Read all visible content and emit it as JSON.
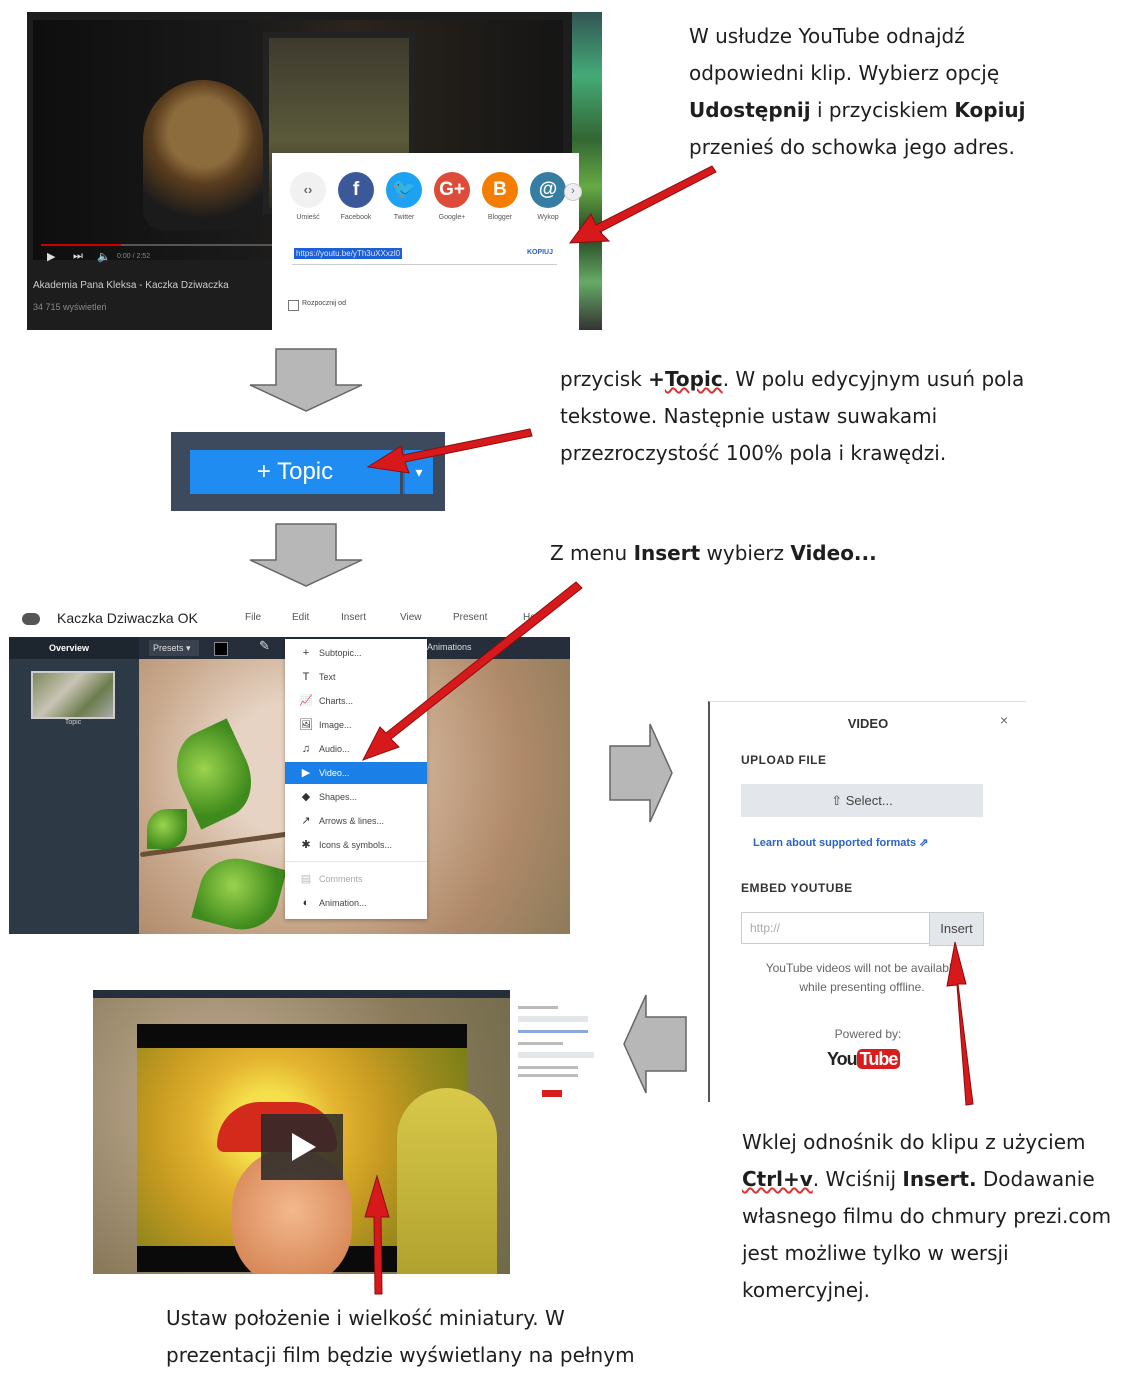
{
  "youtube": {
    "share_targets": [
      {
        "label": "Umieść",
        "glyph": "‹›",
        "color": "#f1f1f1"
      },
      {
        "label": "Facebook",
        "glyph": "f",
        "color": "#3b5998"
      },
      {
        "label": "Twitter",
        "glyph": "🐦",
        "color": "#1da1f2"
      },
      {
        "label": "Google+",
        "glyph": "G+",
        "color": "#dd4b39"
      },
      {
        "label": "Blogger",
        "glyph": "B",
        "color": "#f57d00"
      },
      {
        "label": "Wykop",
        "glyph": "@",
        "color": "#367da3"
      }
    ],
    "url": "https://youtu.be/yTh3uXXxzl0",
    "copy_label": "KOPIUJ",
    "start_label": "Rozpocznij od",
    "video_title": "Akademia Pana Kleksa - Kaczka Dziwaczka",
    "views": "34 715 wyświetleń",
    "time": "0:00 / 2:52"
  },
  "captions": {
    "c1": {
      "l1": "W usłudze YouTube odnajdź",
      "l2": "odpowiedni klip. Wybierz opcję",
      "l3a": "Udostępnij",
      "l3b": " i przyciskiem ",
      "l3c": "Kopiuj",
      "l4": "przenieś do schowka jego adres."
    },
    "c2": {
      "l1a": "przycisk ",
      "l1b": "+",
      "l1c": "Topic",
      "l1d": ". W polu edycyjnym usuń pola",
      "l2": "tekstowe. Następnie ustaw suwakami",
      "l3": "przezroczystość 100% pola i krawędzi."
    },
    "c3": {
      "a": "Z menu ",
      "b": "Insert",
      "c": " wybierz ",
      "d": "Video..."
    },
    "c4": {
      "l1": "Wklej odnośnik do klipu z użyciem",
      "l2a": "Ctrl+v",
      "l2b": ". Wciśnij ",
      "l2c": "Insert.",
      "l2d": " Dodawanie",
      "l3": "własnego filmu do chmury prezi.com",
      "l4": "jest możliwe  tylko w wersji",
      "l5": "komercyjnej."
    },
    "c5": {
      "l1": "Ustaw  położenie i wielkość miniatury.  W",
      "l2": "prezentacji film będzie wyświetlany na pełnym"
    }
  },
  "topic_button": {
    "label": "+ Topic",
    "dropdown": "▾"
  },
  "editor": {
    "title": "Kaczka Dziwaczka OK",
    "menus": [
      "File",
      "Edit",
      "Insert",
      "View",
      "Present",
      "Help"
    ],
    "overview": "Overview",
    "presets": "Presets ▾",
    "animations": "Animations",
    "thumb_label": "Topic",
    "insert_menu": [
      {
        "glyph": "+",
        "label": "Subtopic..."
      },
      {
        "glyph": "T",
        "label": "Text"
      },
      {
        "glyph": "📈",
        "label": "Charts..."
      },
      {
        "glyph": "🖼",
        "label": "Image..."
      },
      {
        "glyph": "♫",
        "label": "Audio..."
      },
      {
        "glyph": "▶",
        "label": "Video..."
      },
      {
        "glyph": "◆",
        "label": "Shapes..."
      },
      {
        "glyph": "↗",
        "label": "Arrows & lines..."
      },
      {
        "glyph": "✱",
        "label": "Icons & symbols..."
      },
      {
        "glyph": "▤",
        "label": "Comments"
      },
      {
        "glyph": "◐",
        "label": "Animation..."
      }
    ]
  },
  "video_dialog": {
    "title": "VIDEO",
    "close": "×",
    "upload_heading": "UPLOAD FILE",
    "select_label": "Select...",
    "learn_link": "Learn about supported formats",
    "embed_heading": "EMBED YOUTUBE",
    "input_placeholder": "http://",
    "insert_label": "Insert",
    "note": "YouTube videos will not be available while presenting offline.",
    "powered_by": "Powered by:",
    "logo_you": "You",
    "logo_tube": "Tube"
  },
  "colors": {
    "arrow_red": "#d7191b",
    "block_arrow": "#b7b7b7",
    "prezi_blue": "#1f8cf2"
  }
}
